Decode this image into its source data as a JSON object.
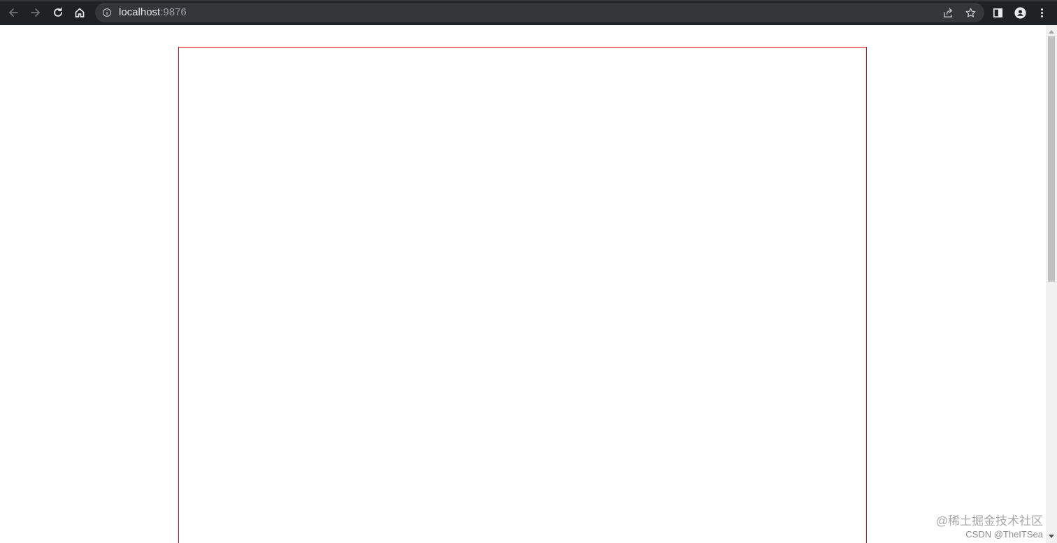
{
  "browser": {
    "url_host": "localhost",
    "url_port": ":9876",
    "icons": {
      "back": "back-arrow-icon",
      "forward": "forward-arrow-icon",
      "reload": "reload-icon",
      "home": "home-icon",
      "info": "info-icon",
      "share": "share-icon",
      "bookmark": "star-icon",
      "side_panel": "side-panel-icon",
      "profile": "profile-icon",
      "menu": "kebab-menu-icon"
    },
    "colors": {
      "toolbar_bg": "#202124",
      "omnibox_bg": "#35363a"
    }
  },
  "page": {
    "box_border_color": "#e60012"
  },
  "watermark": {
    "line1": "@稀土掘金技术社区",
    "line2": "CSDN @TheITSea"
  }
}
